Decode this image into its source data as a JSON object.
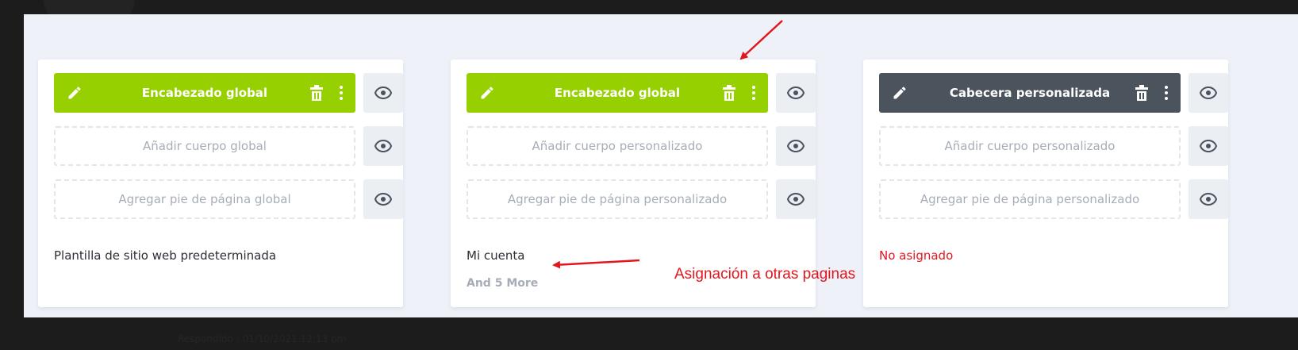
{
  "cards": [
    {
      "header": {
        "label": "Encabezado global",
        "style": "green"
      },
      "body": {
        "label": "Añadir cuerpo global"
      },
      "footer": {
        "label": "Agregar pie de página global"
      },
      "assignment": "Plantilla de sitio web predeterminada",
      "more": ""
    },
    {
      "header": {
        "label": "Encabezado global",
        "style": "green"
      },
      "body": {
        "label": "Añadir cuerpo personalizado"
      },
      "footer": {
        "label": "Agregar pie de página personalizado"
      },
      "assignment": "Mi cuenta",
      "more": "And 5 More"
    },
    {
      "header": {
        "label": "Cabecera personalizada",
        "style": "dark"
      },
      "body": {
        "label": "Añadir cuerpo personalizado"
      },
      "footer": {
        "label": "Agregar pie de página personalizado"
      },
      "assignment": "No asignado",
      "more": ""
    }
  ],
  "annotation": {
    "text": "Asignación a otras paginas"
  },
  "timestamp": "Respondido : 01/10/2021 12:13 pm",
  "colors": {
    "global_header": "#97d000",
    "custom_header": "#4b535d",
    "annotation": "#e3161e",
    "unassigned": "#e3161e",
    "panel_bg": "#eef2f8"
  },
  "icons": [
    "pencil-icon",
    "trash-icon",
    "kebab-menu-icon",
    "eye-icon",
    "annotation-arrow"
  ]
}
